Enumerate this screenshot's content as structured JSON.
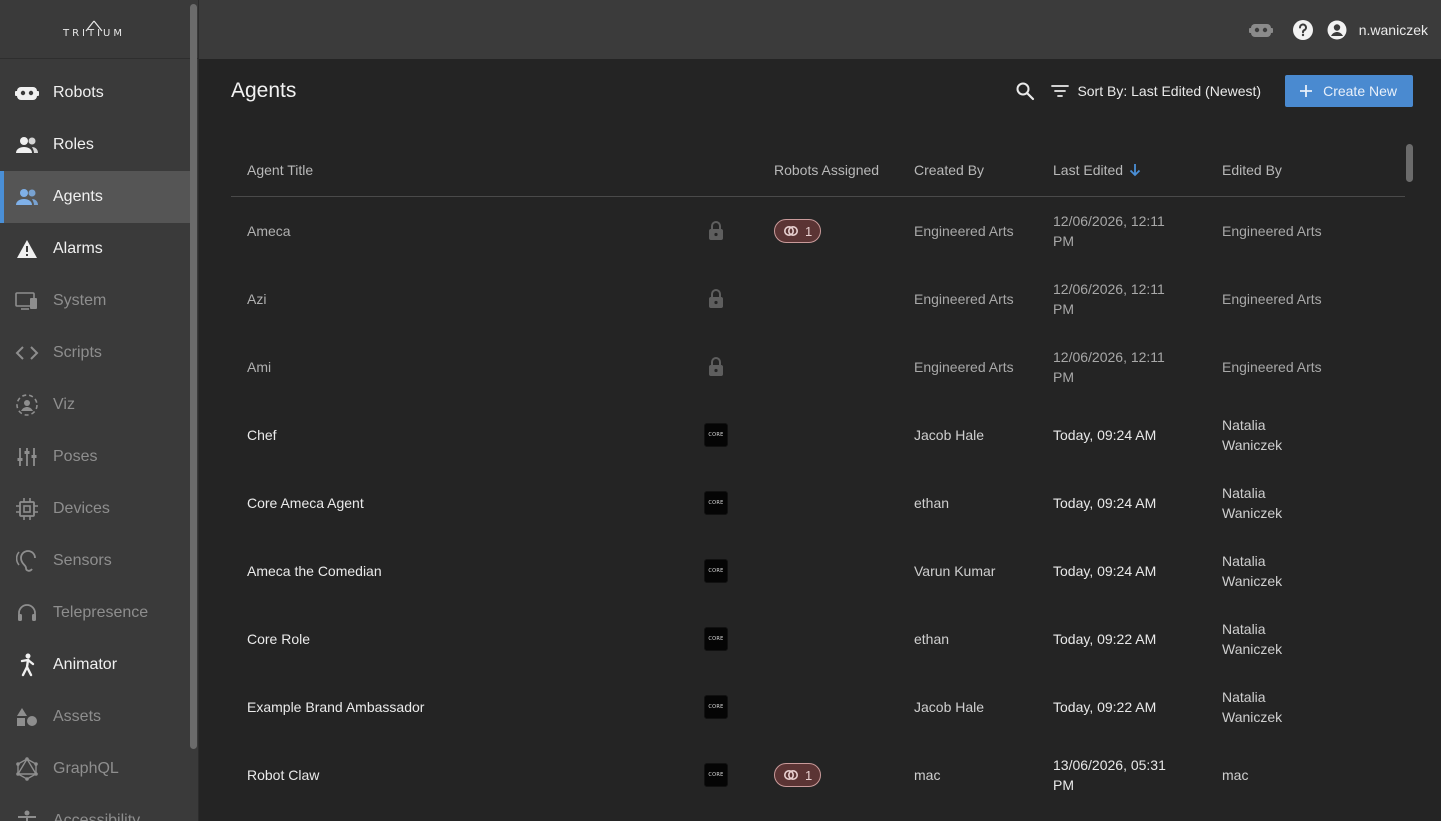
{
  "app": {
    "logo_text": "TRITIUM"
  },
  "sidebar": {
    "items": [
      {
        "label": "Robots",
        "icon": "robot-icon",
        "state": "bright"
      },
      {
        "label": "Roles",
        "icon": "people-icon",
        "state": "bright"
      },
      {
        "label": "Agents",
        "icon": "people-icon",
        "state": "active"
      },
      {
        "label": "Alarms",
        "icon": "warning-icon",
        "state": "bright"
      },
      {
        "label": "System",
        "icon": "monitor-icon",
        "state": "dim"
      },
      {
        "label": "Scripts",
        "icon": "code-icon",
        "state": "dim"
      },
      {
        "label": "Viz",
        "icon": "face-scan-icon",
        "state": "dim"
      },
      {
        "label": "Poses",
        "icon": "sliders-icon",
        "state": "dim"
      },
      {
        "label": "Devices",
        "icon": "chip-icon",
        "state": "dim"
      },
      {
        "label": "Sensors",
        "icon": "ear-icon",
        "state": "dim"
      },
      {
        "label": "Telepresence",
        "icon": "headset-icon",
        "state": "dim"
      },
      {
        "label": "Animator",
        "icon": "person-walk-icon",
        "state": "bright"
      },
      {
        "label": "Assets",
        "icon": "shapes-icon",
        "state": "dim"
      },
      {
        "label": "GraphQL",
        "icon": "graphql-icon",
        "state": "dim"
      },
      {
        "label": "Accessibility",
        "icon": "accessibility-icon",
        "state": "dim"
      }
    ]
  },
  "topbar": {
    "username": "n.waniczek"
  },
  "page": {
    "title": "Agents",
    "sort_label": "Sort By: Last Edited (Newest)",
    "create_label": "Create New"
  },
  "table": {
    "headers": {
      "title": "Agent Title",
      "robots": "Robots Assigned",
      "created_by": "Created By",
      "last_edited": "Last Edited",
      "edited_by": "Edited By"
    },
    "rows": [
      {
        "title": "Ameca",
        "badge": "lock",
        "robots": "1",
        "created_by": "Engineered Arts",
        "last_edited_1": "12/06/2026, 12:11",
        "last_edited_2": "PM",
        "edited_by_1": "Engineered Arts",
        "edited_by_2": ""
      },
      {
        "title": "Azi",
        "badge": "lock",
        "robots": "",
        "created_by": "Engineered Arts",
        "last_edited_1": "12/06/2026, 12:11",
        "last_edited_2": "PM",
        "edited_by_1": "Engineered Arts",
        "edited_by_2": ""
      },
      {
        "title": "Ami",
        "badge": "lock",
        "robots": "",
        "created_by": "Engineered Arts",
        "last_edited_1": "12/06/2026, 12:11",
        "last_edited_2": "PM",
        "edited_by_1": "Engineered Arts",
        "edited_by_2": ""
      },
      {
        "title": "Chef",
        "badge": "CORE",
        "robots": "",
        "created_by": "Jacob Hale",
        "last_edited_1": "Today, 09:24 AM",
        "last_edited_2": "",
        "edited_by_1": "Natalia",
        "edited_by_2": "Waniczek"
      },
      {
        "title": "Core Ameca Agent",
        "badge": "CORE",
        "robots": "",
        "created_by": "ethan",
        "last_edited_1": "Today, 09:24 AM",
        "last_edited_2": "",
        "edited_by_1": "Natalia",
        "edited_by_2": "Waniczek"
      },
      {
        "title": "Ameca the Comedian",
        "badge": "CORE",
        "robots": "",
        "created_by": "Varun Kumar",
        "last_edited_1": "Today, 09:24 AM",
        "last_edited_2": "",
        "edited_by_1": "Natalia",
        "edited_by_2": "Waniczek"
      },
      {
        "title": "Core Role",
        "badge": "CORE",
        "robots": "",
        "created_by": "ethan",
        "last_edited_1": "Today, 09:22 AM",
        "last_edited_2": "",
        "edited_by_1": "Natalia",
        "edited_by_2": "Waniczek"
      },
      {
        "title": "Example Brand Ambassador",
        "badge": "CORE",
        "robots": "",
        "created_by": "Jacob Hale",
        "last_edited_1": "Today, 09:22 AM",
        "last_edited_2": "",
        "edited_by_1": "Natalia",
        "edited_by_2": "Waniczek"
      },
      {
        "title": "Robot Claw",
        "badge": "CORE",
        "robots": "1",
        "created_by": "mac",
        "last_edited_1": "13/06/2026, 05:31",
        "last_edited_2": "PM",
        "edited_by_1": "mac",
        "edited_by_2": ""
      }
    ]
  },
  "colors": {
    "accent": "#4a8ad0",
    "active_bar": "#4a8fd6",
    "chip_bg": "#5b3434",
    "chip_border": "#c99a9a"
  }
}
